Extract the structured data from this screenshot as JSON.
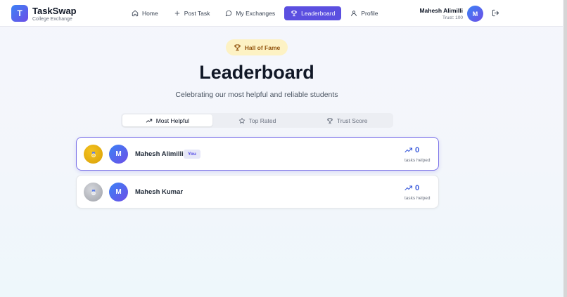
{
  "header": {
    "logo_letter": "T",
    "brand_name": "TaskSwap",
    "brand_sub": "College Exchange",
    "nav": [
      {
        "label": "Home",
        "icon": "home-icon"
      },
      {
        "label": "Post Task",
        "icon": "plus-icon"
      },
      {
        "label": "My Exchanges",
        "icon": "chat-bubble-icon"
      },
      {
        "label": "Leaderboard",
        "icon": "trophy-icon",
        "active": true
      },
      {
        "label": "Profile",
        "icon": "user-icon"
      }
    ],
    "user_name": "Mahesh Alimilli",
    "user_trust": "Trust: 100",
    "avatar_letter": "M"
  },
  "hero": {
    "badge": "Hall of Fame",
    "title": "Leaderboard",
    "subtitle": "Celebrating our most helpful and reliable students"
  },
  "tabs": [
    {
      "label": "Most Helpful",
      "icon": "trending-up-icon",
      "active": true
    },
    {
      "label": "Top Rated",
      "icon": "star-icon"
    },
    {
      "label": "Trust Score",
      "icon": "trophy-icon"
    }
  ],
  "entries": [
    {
      "avatar_letter": "M",
      "name": "Mahesh Alimilli",
      "tag": "You",
      "value": "0",
      "value_label": "tasks helped",
      "rank_medal": "gold"
    },
    {
      "avatar_letter": "M",
      "name": "Mahesh Kumar",
      "value": "0",
      "value_label": "tasks helped",
      "rank_medal": "silver"
    }
  ],
  "colors": {
    "accent": "#5b4fe0",
    "gold": "#e0a90d",
    "silver": "#b3b6bd",
    "stat": "#3b5bdb"
  }
}
